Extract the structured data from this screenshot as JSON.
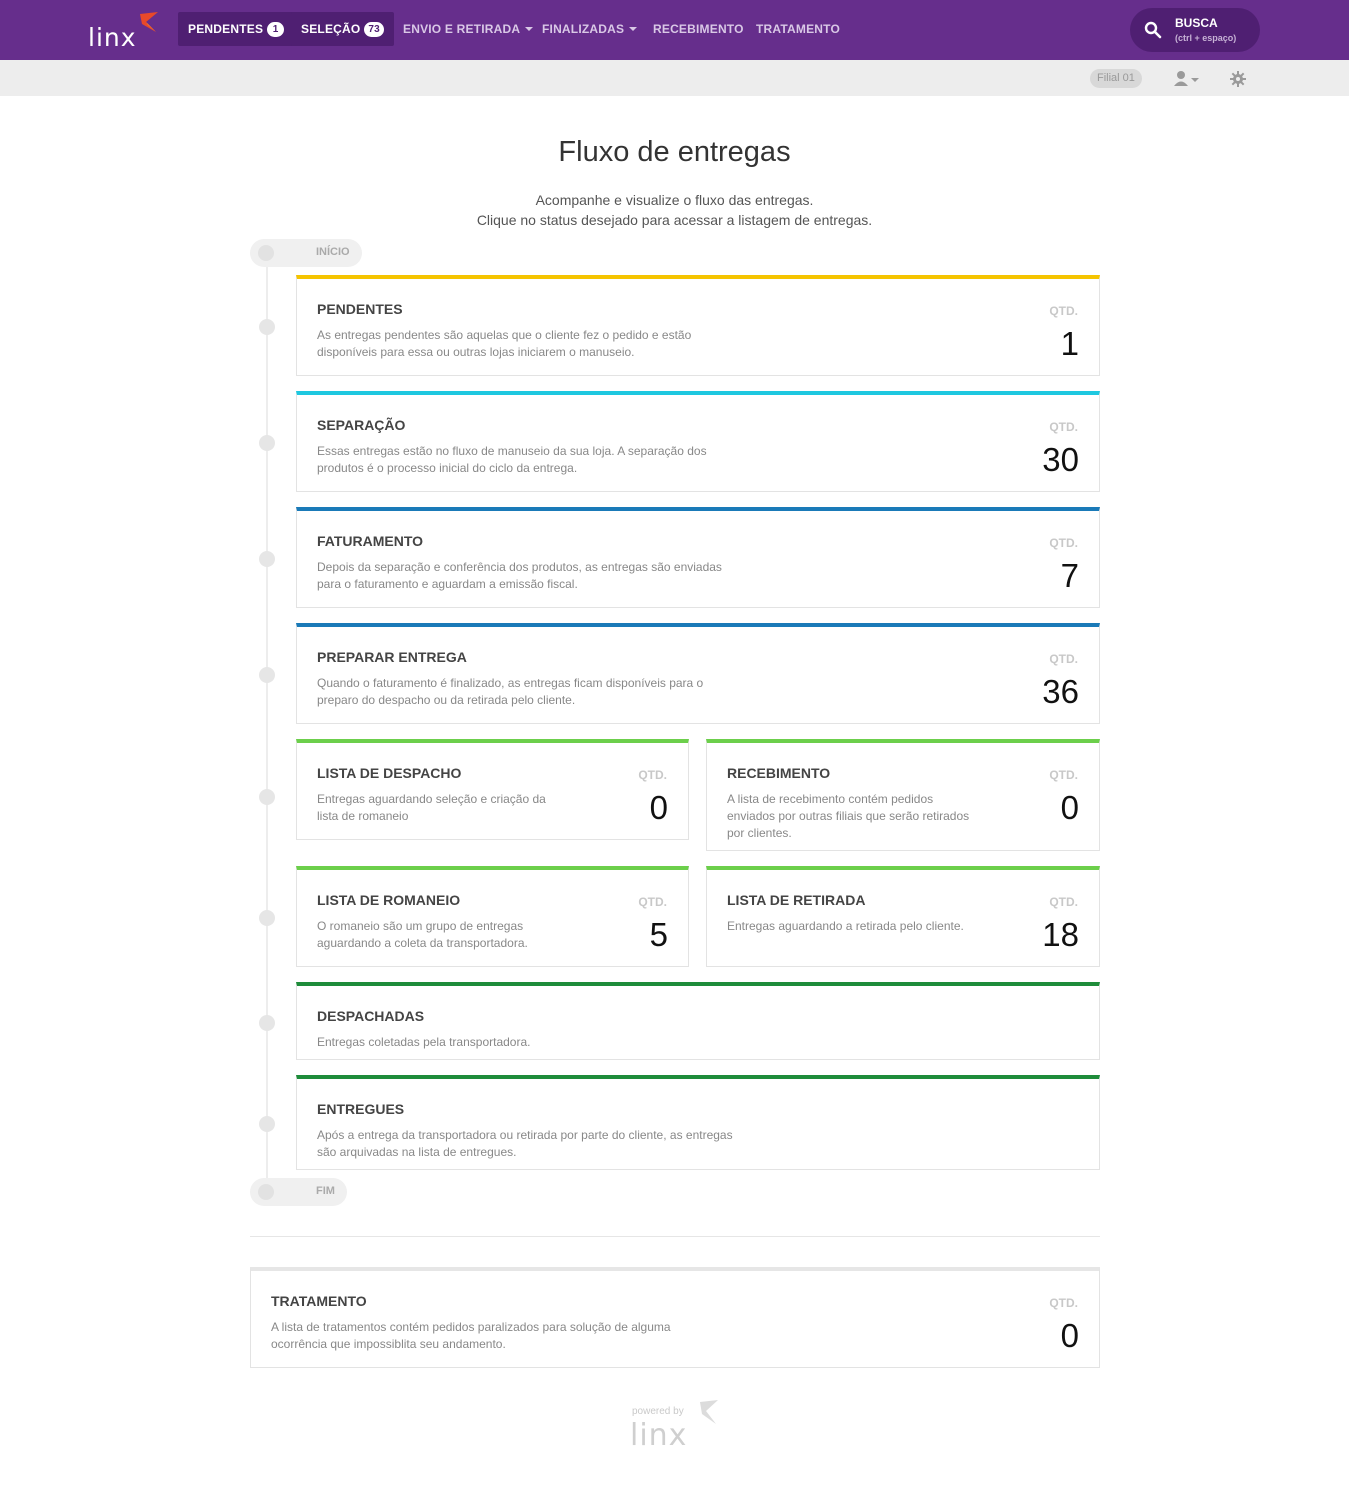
{
  "header": {
    "logo_text": "linx",
    "nav": [
      {
        "label": "PENDENTES",
        "badge": "1",
        "active": true
      },
      {
        "label": "SELEÇÃO",
        "badge": "73",
        "active": true
      },
      {
        "label": "ENVIO E RETIRADA",
        "dropdown": true
      },
      {
        "label": "FINALIZADAS",
        "dropdown": true
      },
      {
        "label": "RECEBIMENTO"
      },
      {
        "label": "TRATAMENTO"
      }
    ],
    "search": {
      "label": "BUSCA",
      "hint": "(ctrl + espaço)"
    },
    "colors": {
      "brand": "#662e8c",
      "brand_dark": "#4f1f72"
    }
  },
  "subbar": {
    "branch": "Filial 01",
    "user_icon": "user-icon",
    "settings_icon": "gear-icon"
  },
  "page": {
    "title": "Fluxo de entregas",
    "subtitle_line1": "Acompanhe e visualize o fluxo das entregas.",
    "subtitle_line2": "Clique no status desejado para acessar a listagem de entregas.",
    "start_label": "INÍCIO",
    "end_label": "FIM"
  },
  "qtd_label": "QTD.",
  "cards": {
    "pendentes": {
      "title": "PENDENTES",
      "desc1": "As entregas pendentes são aquelas que o cliente fez o pedido e estão",
      "desc2": "disponíveis para essa ou outras lojas iniciarem o manuseio.",
      "count": "1",
      "color": "#f5c400"
    },
    "separacao": {
      "title": "SEPARAÇÃO",
      "desc1": "Essas entregas estão no fluxo de manuseio da sua loja. A separação dos",
      "desc2": "produtos é o processo inicial do ciclo da entrega.",
      "count": "30",
      "color": "#1ec8e0"
    },
    "faturamento": {
      "title": "FATURAMENTO",
      "desc1": "Depois da separação e conferência dos produtos, as entregas são enviadas",
      "desc2": "para o faturamento e aguardam a emissão fiscal.",
      "count": "7",
      "color": "#1a7ab8"
    },
    "preparar": {
      "title": "PREPARAR ENTREGA",
      "desc1": "Quando o faturamento é finalizado, as entregas ficam disponíveis para o",
      "desc2": "preparo do despacho ou da retirada pelo cliente.",
      "count": "36",
      "color": "#1a7ab8"
    },
    "despacho": {
      "title": "LISTA DE DESPACHO",
      "desc1": "Entregas aguardando seleção e criação da",
      "desc2": "lista de romaneio",
      "count": "0",
      "color": "#6ccf4b"
    },
    "recebimento": {
      "title": "RECEBIMENTO",
      "desc1": "A lista de recebimento contém pedidos",
      "desc2": "enviados por outras filiais que serão retirados",
      "desc3": "por clientes.",
      "count": "0",
      "color": "#6ccf4b"
    },
    "romaneio": {
      "title": "LISTA DE ROMANEIO",
      "desc1": "O romaneio são um grupo de entregas",
      "desc2": "aguardando a coleta da transportadora.",
      "count": "5",
      "color": "#6ccf4b"
    },
    "retirada": {
      "title": "LISTA DE RETIRADA",
      "desc1": "Entregas aguardando a retirada pelo cliente.",
      "count": "18",
      "color": "#6ccf4b"
    },
    "despachadas": {
      "title": "DESPACHADAS",
      "desc1": "Entregas coletadas pela transportadora.",
      "color": "#1e8c3a"
    },
    "entregues": {
      "title": "ENTREGUES",
      "desc1": "Após a entrega da transportadora ou retirada por parte do cliente, as entregas",
      "desc2": "são arquivadas na lista de entregues.",
      "color": "#1e8c3a"
    },
    "tratamento": {
      "title": "TRATAMENTO",
      "desc1": "A lista de tratamentos contém pedidos paralizados para solução de alguma",
      "desc2": "ocorrência que impossiblita seu andamento.",
      "count": "0",
      "color": "#e6e6e6"
    }
  },
  "footer": {
    "powered_by": "powered by",
    "logo_text": "linx"
  }
}
